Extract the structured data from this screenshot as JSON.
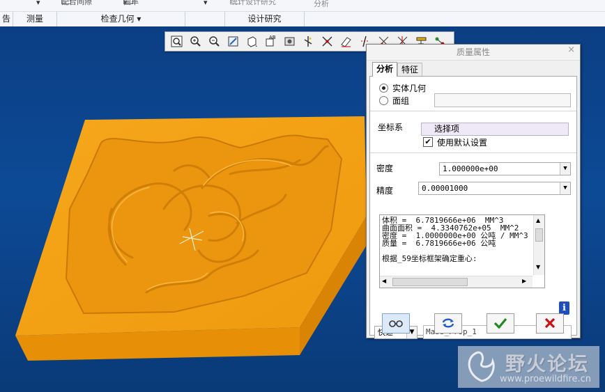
{
  "ribbon": {
    "top_items": [
      "▾",
      "配合间隙",
      "曲率",
      "▾",
      "▾",
      "统计设计研究",
      "分析"
    ],
    "groups": [
      "告",
      "测量",
      "检查几何 ▾",
      "",
      "设计研究",
      ""
    ]
  },
  "toolbar": {
    "icons": [
      "zoom-fit-icon",
      "zoom-in-icon",
      "zoom-out-icon",
      "repaint-icon",
      "display-style-icon",
      "view-manager-icon",
      "saved-views-icon",
      "layer-icon",
      "datum-plane-icon",
      "annotation-icon",
      "datum-axis-icon",
      "datum-point-icon",
      "csys-icon",
      "spin-center-icon",
      "appearance-icon"
    ]
  },
  "dialog": {
    "title": "质量属性",
    "close": "×",
    "tabs": [
      "分析",
      "特征"
    ],
    "radio_solid": "实体几何",
    "radio_quilt": "面组",
    "csys_label": "坐标系",
    "select_items": "选择项",
    "use_default": "使用默认设置",
    "density_label": "密度",
    "density_value": "1.000000e+00",
    "precision_label": "精度",
    "precision_value": "0.00001000",
    "results": {
      "line1": "体积 =  6.7819666e+06  MM^3",
      "line2": "曲面面积 =  4.3340762e+05  MM^2",
      "line3": "密度 =  1.0000000e+00 公吨 / MM^3",
      "line4": "质量 =  6.7819666e+06 公吨",
      "line5": "根据_59坐标框架确定重心:"
    },
    "mode_value": "快速",
    "name_value": "Mass_Prop_1",
    "info": "i"
  },
  "watermark": {
    "title": "野火论坛",
    "url": "www.proewildfire.cn"
  },
  "colors": {
    "model": "#f29e12",
    "model_side": "#e08a05",
    "viewport": "#0c4690",
    "accept": "#1f8a1f",
    "cancel": "#cc1010"
  }
}
